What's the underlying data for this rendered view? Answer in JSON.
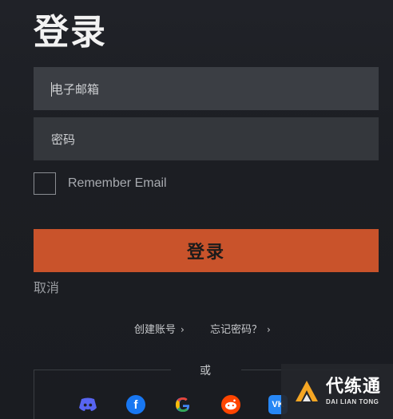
{
  "title": "登录",
  "form": {
    "email_placeholder": "电子邮箱",
    "password_placeholder": "密码",
    "remember_label": "Remember Email",
    "remember_checked": false,
    "login_button": "登录",
    "cancel_link": "取消"
  },
  "links": {
    "create_account": "创建账号",
    "forgot_password": "忘记密码？"
  },
  "divider_text": "或",
  "social_logins": [
    {
      "name": "discord",
      "icon": "discord-icon",
      "color": "#5865f2"
    },
    {
      "name": "facebook",
      "icon": "facebook-icon",
      "color": "#1877f2"
    },
    {
      "name": "google",
      "icon": "google-icon",
      "color": "#4285f4"
    },
    {
      "name": "reddit",
      "icon": "reddit-icon",
      "color": "#ff4500"
    },
    {
      "name": "vk",
      "icon": "vk-icon",
      "color": "#2787f5"
    }
  ],
  "watermark": {
    "main": "代练通",
    "sub": "DAI LIAN TONG"
  },
  "colors": {
    "accent": "#c9532b",
    "background": "#1d1f25",
    "input_bg": "#3a3d43"
  }
}
